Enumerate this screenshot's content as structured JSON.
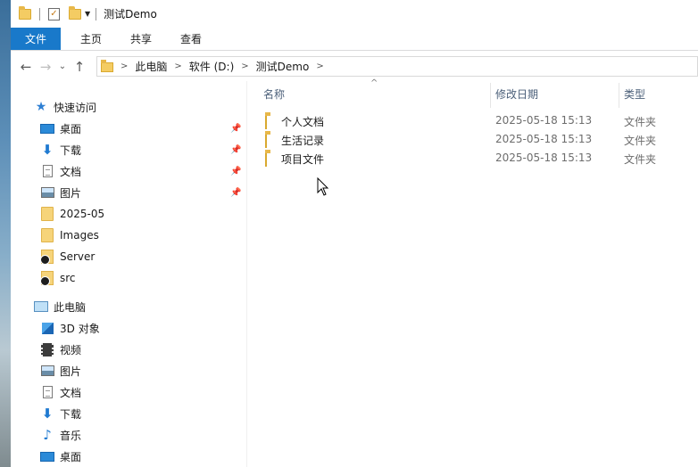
{
  "title_bar": {
    "title": "测试Demo"
  },
  "ribbon": {
    "tabs": [
      "文件",
      "主页",
      "共享",
      "查看"
    ]
  },
  "address": {
    "crumbs": [
      "此电脑",
      "软件 (D:)",
      "测试Demo"
    ]
  },
  "nav": {
    "quick_access_label": "快速访问",
    "quick_items": [
      {
        "label": "桌面",
        "icon": "desktop-icon",
        "pinned": true
      },
      {
        "label": "下载",
        "icon": "download-icon",
        "pinned": true
      },
      {
        "label": "文档",
        "icon": "document-icon",
        "pinned": true
      },
      {
        "label": "图片",
        "icon": "pictures-icon",
        "pinned": true
      },
      {
        "label": "2025-05",
        "icon": "folder-icon",
        "pinned": false
      },
      {
        "label": "Images",
        "icon": "folder-icon",
        "pinned": false
      },
      {
        "label": "Server",
        "icon": "network-folder-icon",
        "pinned": false
      },
      {
        "label": "src",
        "icon": "network-folder-icon",
        "pinned": false
      }
    ],
    "this_pc_label": "此电脑",
    "pc_items": [
      {
        "label": "3D 对象",
        "icon": "3d-objects-icon"
      },
      {
        "label": "视频",
        "icon": "video-icon"
      },
      {
        "label": "图片",
        "icon": "pictures-icon"
      },
      {
        "label": "文档",
        "icon": "document-icon"
      },
      {
        "label": "下载",
        "icon": "download-icon"
      },
      {
        "label": "音乐",
        "icon": "music-icon"
      },
      {
        "label": "桌面",
        "icon": "desktop-icon"
      }
    ]
  },
  "file_list": {
    "columns": {
      "name": "名称",
      "date": "修改日期",
      "type": "类型"
    },
    "rows": [
      {
        "name": "个人文档",
        "date": "2025-05-18 15:13",
        "type": "文件夹"
      },
      {
        "name": "生活记录",
        "date": "2025-05-18 15:13",
        "type": "文件夹"
      },
      {
        "name": "项目文件",
        "date": "2025-05-18 15:13",
        "type": "文件夹"
      }
    ]
  }
}
